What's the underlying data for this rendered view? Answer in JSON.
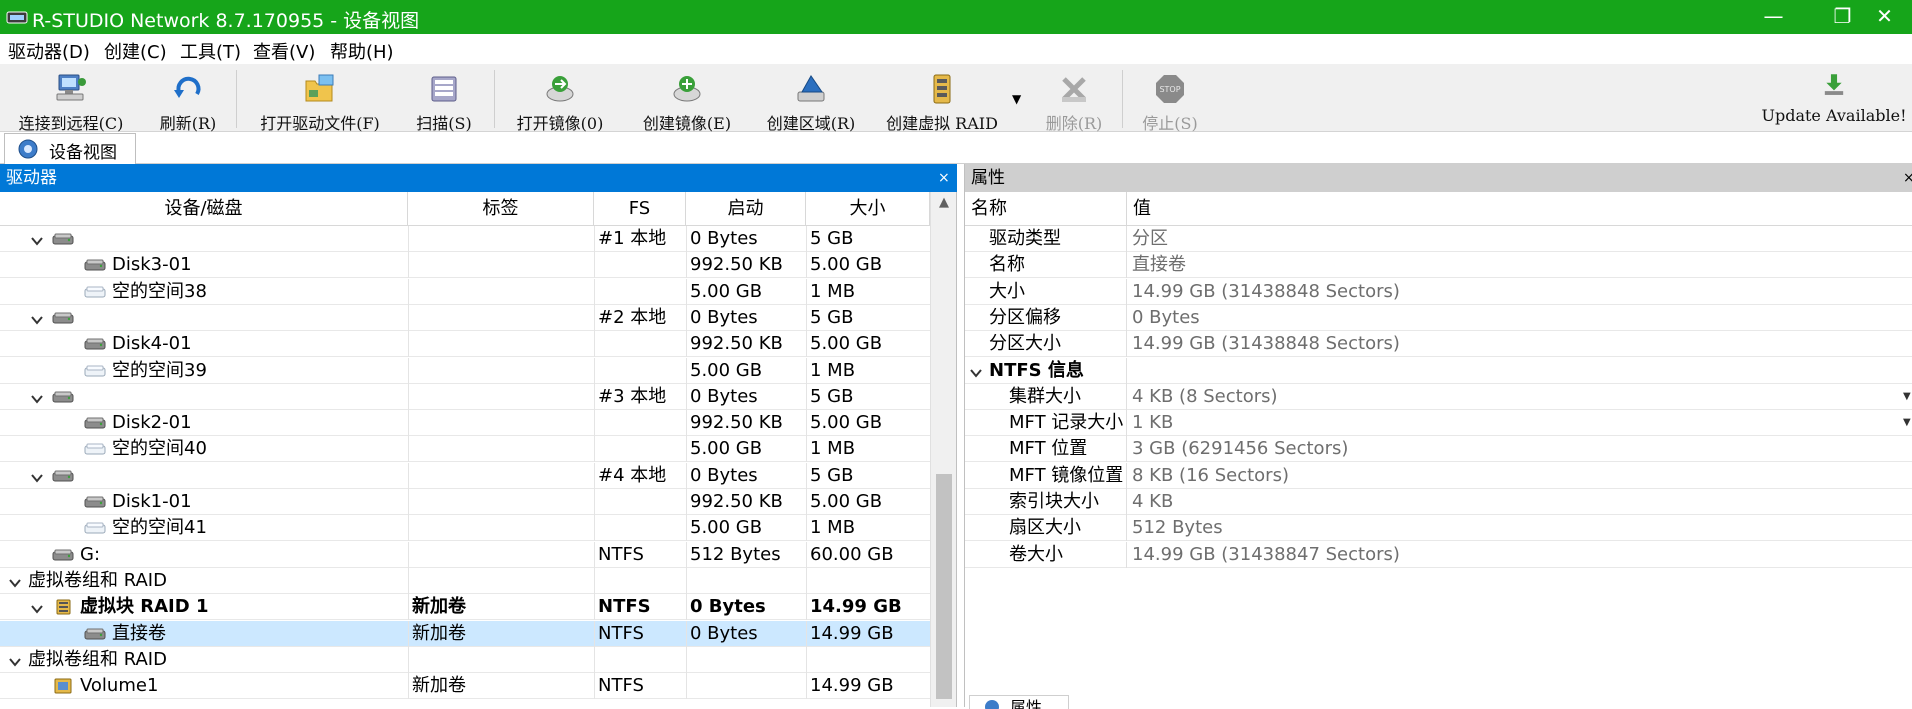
{
  "window": {
    "title": "R-STUDIO Network 8.7.170955 - 设备视图",
    "minimize": "—",
    "maximize": "❐",
    "close": "✕"
  },
  "menu": [
    "驱动器(D)",
    "创建(C)",
    "工具(T)",
    "查看(V)",
    "帮助(H)"
  ],
  "toolbar": {
    "connect": "连接到远程(C)",
    "refresh": "刷新(R)",
    "open_drive_files": "打开驱动文件(F)",
    "scan": "扫描(S)",
    "open_image": "打开镜像(0)",
    "create_image": "创建镜像(E)",
    "create_region": "创建区域(R)",
    "create_virtual_raid": "创建虚拟 RAID",
    "delete": "删除(R)",
    "stop": "停止(S)",
    "update": "Update Available!"
  },
  "tab": {
    "label": "设备视图"
  },
  "drives_panel": {
    "title": "驱动器",
    "close": "×",
    "columns": [
      "设备/磁盘",
      "标签",
      "FS",
      "启动",
      "大小"
    ],
    "rows": [
      {
        "indent": 1,
        "expander": "down",
        "icon": "hdd-icon",
        "name": "",
        "label": "",
        "fs": "#1 本地",
        "start": "0 Bytes",
        "size": "5 GB",
        "bold": false,
        "selected": false
      },
      {
        "indent": 2,
        "expander": "",
        "icon": "hdd-icon",
        "name": "Disk3-01",
        "label": "",
        "fs": "",
        "start": "992.50 KB",
        "size": "5.00 GB",
        "bold": false,
        "selected": false
      },
      {
        "indent": 2,
        "expander": "",
        "icon": "empty-space-icon",
        "name": "空的空间38",
        "label": "",
        "fs": "",
        "start": "5.00 GB",
        "size": "1 MB",
        "bold": false,
        "selected": false
      },
      {
        "indent": 1,
        "expander": "down",
        "icon": "hdd-icon",
        "name": "",
        "label": "",
        "fs": "#2 本地",
        "start": "0 Bytes",
        "size": "5 GB",
        "bold": false,
        "selected": false
      },
      {
        "indent": 2,
        "expander": "",
        "icon": "hdd-icon",
        "name": "Disk4-01",
        "label": "",
        "fs": "",
        "start": "992.50 KB",
        "size": "5.00 GB",
        "bold": false,
        "selected": false
      },
      {
        "indent": 2,
        "expander": "",
        "icon": "empty-space-icon",
        "name": "空的空间39",
        "label": "",
        "fs": "",
        "start": "5.00 GB",
        "size": "1 MB",
        "bold": false,
        "selected": false
      },
      {
        "indent": 1,
        "expander": "down",
        "icon": "hdd-icon",
        "name": "",
        "label": "",
        "fs": "#3 本地",
        "start": "0 Bytes",
        "size": "5 GB",
        "bold": false,
        "selected": false
      },
      {
        "indent": 2,
        "expander": "",
        "icon": "hdd-icon",
        "name": "Disk2-01",
        "label": "",
        "fs": "",
        "start": "992.50 KB",
        "size": "5.00 GB",
        "bold": false,
        "selected": false
      },
      {
        "indent": 2,
        "expander": "",
        "icon": "empty-space-icon",
        "name": "空的空间40",
        "label": "",
        "fs": "",
        "start": "5.00 GB",
        "size": "1 MB",
        "bold": false,
        "selected": false
      },
      {
        "indent": 1,
        "expander": "down",
        "icon": "hdd-icon",
        "name": "",
        "label": "",
        "fs": "#4 本地",
        "start": "0 Bytes",
        "size": "5 GB",
        "bold": false,
        "selected": false
      },
      {
        "indent": 2,
        "expander": "",
        "icon": "hdd-icon",
        "name": "Disk1-01",
        "label": "",
        "fs": "",
        "start": "992.50 KB",
        "size": "5.00 GB",
        "bold": false,
        "selected": false
      },
      {
        "indent": 2,
        "expander": "",
        "icon": "empty-space-icon",
        "name": "空的空间41",
        "label": "",
        "fs": "",
        "start": "5.00 GB",
        "size": "1 MB",
        "bold": false,
        "selected": false
      },
      {
        "indent": 1,
        "expander": "",
        "icon": "hdd-icon",
        "name": "G:",
        "label": "",
        "fs": "NTFS",
        "start": "512 Bytes",
        "size": "60.00 GB",
        "bold": false,
        "selected": false
      },
      {
        "indent": 0,
        "expander": "down",
        "icon": "",
        "name": "虚拟卷组和 RAID",
        "label": "",
        "fs": "",
        "start": "",
        "size": "",
        "bold": false,
        "selected": false
      },
      {
        "indent": 1,
        "expander": "down",
        "icon": "raid-icon",
        "name": "虚拟块 RAID 1",
        "label": "新加卷",
        "fs": "NTFS",
        "start": "0 Bytes",
        "size": "14.99 GB",
        "bold": true,
        "selected": false
      },
      {
        "indent": 2,
        "expander": "",
        "icon": "hdd-icon",
        "name": "直接卷",
        "label": "新加卷",
        "fs": "NTFS",
        "start": "0 Bytes",
        "size": "14.99 GB",
        "bold": false,
        "selected": true
      },
      {
        "indent": 0,
        "expander": "down",
        "icon": "",
        "name": "虚拟卷组和 RAID",
        "label": "",
        "fs": "",
        "start": "",
        "size": "",
        "bold": false,
        "selected": false
      },
      {
        "indent": 1,
        "expander": "",
        "icon": "volume-icon",
        "name": "Volume1",
        "label": "新加卷",
        "fs": "NTFS",
        "start": "",
        "size": "14.99 GB",
        "bold": false,
        "selected": false
      }
    ]
  },
  "properties_panel": {
    "title": "属性",
    "close": "×",
    "columns": [
      "名称",
      "值"
    ],
    "rows": [
      {
        "key": "驱动类型",
        "value": "分区",
        "level": 1,
        "group": false,
        "dropdown": false
      },
      {
        "key": "名称",
        "value": "直接卷",
        "level": 1,
        "group": false,
        "dropdown": false
      },
      {
        "key": "大小",
        "value": "14.99 GB (31438848 Sectors)",
        "level": 1,
        "group": false,
        "dropdown": false
      },
      {
        "key": "分区偏移",
        "value": "0 Bytes",
        "level": 1,
        "group": false,
        "dropdown": false
      },
      {
        "key": "分区大小",
        "value": "14.99 GB (31438848 Sectors)",
        "level": 1,
        "group": false,
        "dropdown": false
      },
      {
        "key": "NTFS 信息",
        "value": "",
        "level": 0,
        "group": true,
        "dropdown": false
      },
      {
        "key": "集群大小",
        "value": "4 KB (8 Sectors)",
        "level": 2,
        "group": false,
        "dropdown": true
      },
      {
        "key": "MFT 记录大小",
        "value": "1 KB",
        "level": 2,
        "group": false,
        "dropdown": true
      },
      {
        "key": "MFT 位置",
        "value": "3 GB (6291456 Sectors)",
        "level": 2,
        "group": false,
        "dropdown": false
      },
      {
        "key": "MFT 镜像位置",
        "value": "8 KB (16 Sectors)",
        "level": 2,
        "group": false,
        "dropdown": false
      },
      {
        "key": "索引块大小",
        "value": "4 KB",
        "level": 2,
        "group": false,
        "dropdown": false
      },
      {
        "key": "扇区大小",
        "value": "512 Bytes",
        "level": 2,
        "group": false,
        "dropdown": false
      },
      {
        "key": "卷大小",
        "value": "14.99 GB (31438847 Sectors)",
        "level": 2,
        "group": false,
        "dropdown": false
      }
    ],
    "bottom_tab": "属性"
  },
  "colors": {
    "titlebar": "#16a51a",
    "drives_header": "#0078d7",
    "selection": "#cce8ff",
    "property_value": "#6e6e6e"
  }
}
